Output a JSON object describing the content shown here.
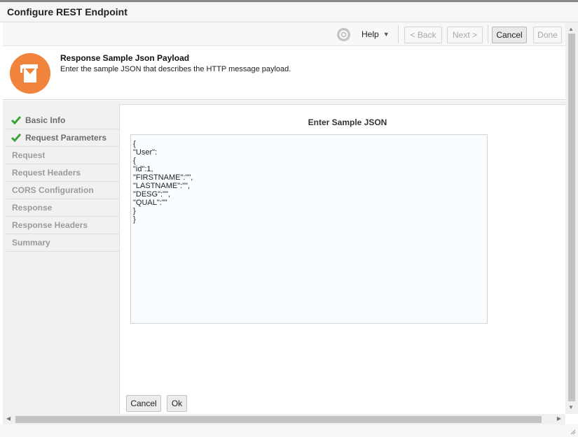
{
  "window": {
    "title": "Configure REST Endpoint"
  },
  "toolbar": {
    "help_label": "Help",
    "back_label": "< Back",
    "next_label": "Next >",
    "cancel_label": "Cancel",
    "done_label": "Done"
  },
  "header": {
    "title": "Response Sample Json Payload",
    "description": "Enter the sample JSON that describes the HTTP message payload.",
    "badge_color": "#f0843c"
  },
  "nav": {
    "items": [
      {
        "label": "Basic Info",
        "completed": true
      },
      {
        "label": "Request Parameters",
        "completed": true
      },
      {
        "label": "Request",
        "completed": false
      },
      {
        "label": "Request Headers",
        "completed": false
      },
      {
        "label": "CORS Configuration",
        "completed": false
      },
      {
        "label": "Response",
        "completed": false
      },
      {
        "label": "Response Headers",
        "completed": false
      },
      {
        "label": "Summary",
        "completed": false
      }
    ]
  },
  "content": {
    "title": "Enter Sample JSON",
    "json_value": "{\n\"User\":\n{\n\"id\":1,\n\"FIRSTNAME\":\"\",\n\"LASTNAME\":\"\",\n\"DESG\":\"\",\n\"QUAL\":\"\"\n}\n}",
    "cancel_label": "Cancel",
    "ok_label": "Ok"
  },
  "colors": {
    "check_green": "#3aa335",
    "accent_orange": "#f0843c"
  }
}
